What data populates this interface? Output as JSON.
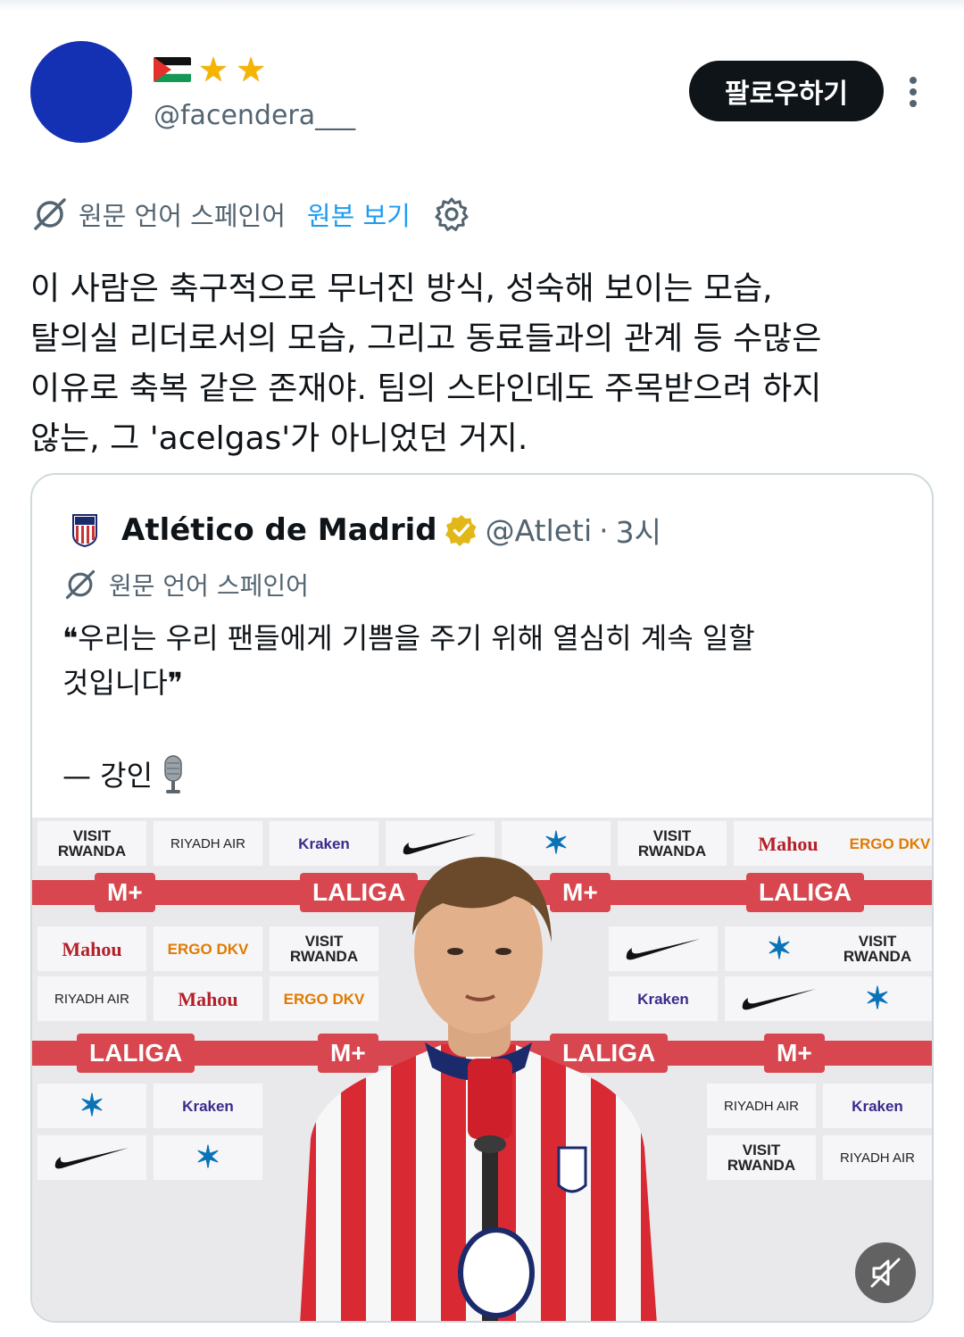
{
  "author": {
    "handle": "@facendera___",
    "name_icons": [
      "palestine-flag-icon",
      "star-icon",
      "star-icon"
    ],
    "avatar_color": "#1431b4"
  },
  "follow_button": {
    "label": "팔로우하기"
  },
  "translation": {
    "label": "원문 언어 스페인어",
    "link": "원본 보기"
  },
  "tweet": {
    "lines": [
      "이 사람은 축구적으로 무너진 방식, 성숙해 보이는 모습,",
      "탈의실 리더로서의 모습, 그리고 동료들과의 관계 등 수많은",
      "이유로 축복 같은 존재야. 팀의 스타인데도 주목받으려 하지",
      "않는, 그 'acelgas'가 아니었던 거지."
    ]
  },
  "quoted": {
    "name": "Atlético de Madrid",
    "handle": "@Atleti",
    "separator": "·",
    "time": "3시",
    "translation_label": "원문 언어 스페인어",
    "body_lines": [
      "❝우리는 우리 팬들에게 기쁨을 주기 위해 열심히 계속 일할",
      "것입니다❞"
    ],
    "attribution": "— 강인",
    "media": {
      "sponsors": [
        "VISIT RWANDA",
        "RIYADH AIR",
        "Kraken",
        "Mahou",
        "ERGO DKV",
        "LALIGA",
        "M+"
      ],
      "mute_icon": "mute-icon"
    }
  },
  "colors": {
    "accent": "#1d9bf0",
    "text": "#0f1419",
    "secondary": "#536471",
    "border": "#cfd9de"
  }
}
